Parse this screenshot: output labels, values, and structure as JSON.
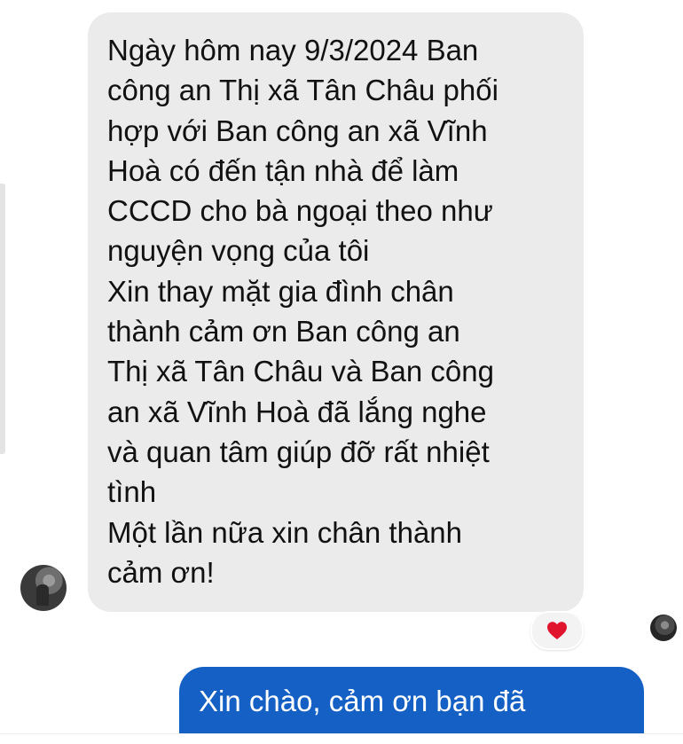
{
  "colors": {
    "incoming_bubble": "#ebebeb",
    "outgoing_bubble": "#1560c4",
    "reaction_heart": "#e0142c"
  },
  "messages": [
    {
      "direction": "incoming",
      "lines": [
        "Ngày hôm nay 9/3/2024 Ban",
        "công an Thị xã Tân Châu phối",
        "hợp với Ban công an xã Vĩnh",
        "Hoà có đến tận nhà để làm",
        "CCCD cho bà ngoại theo như",
        "nguyện vọng của tôi",
        "Xin thay mặt gia đình chân",
        "thành cảm ơn Ban công an",
        "Thị xã Tân Châu và Ban công",
        "an xã Vĩnh Hoà đã lắng nghe",
        "và quan tâm giúp đỡ rất nhiệt",
        "tình",
        "Một lần nữa xin chân thành",
        "cảm ơn!"
      ],
      "reaction_icon": "heart-icon"
    },
    {
      "direction": "outgoing",
      "text": "Xin chào, cảm ơn bạn đã"
    }
  ]
}
